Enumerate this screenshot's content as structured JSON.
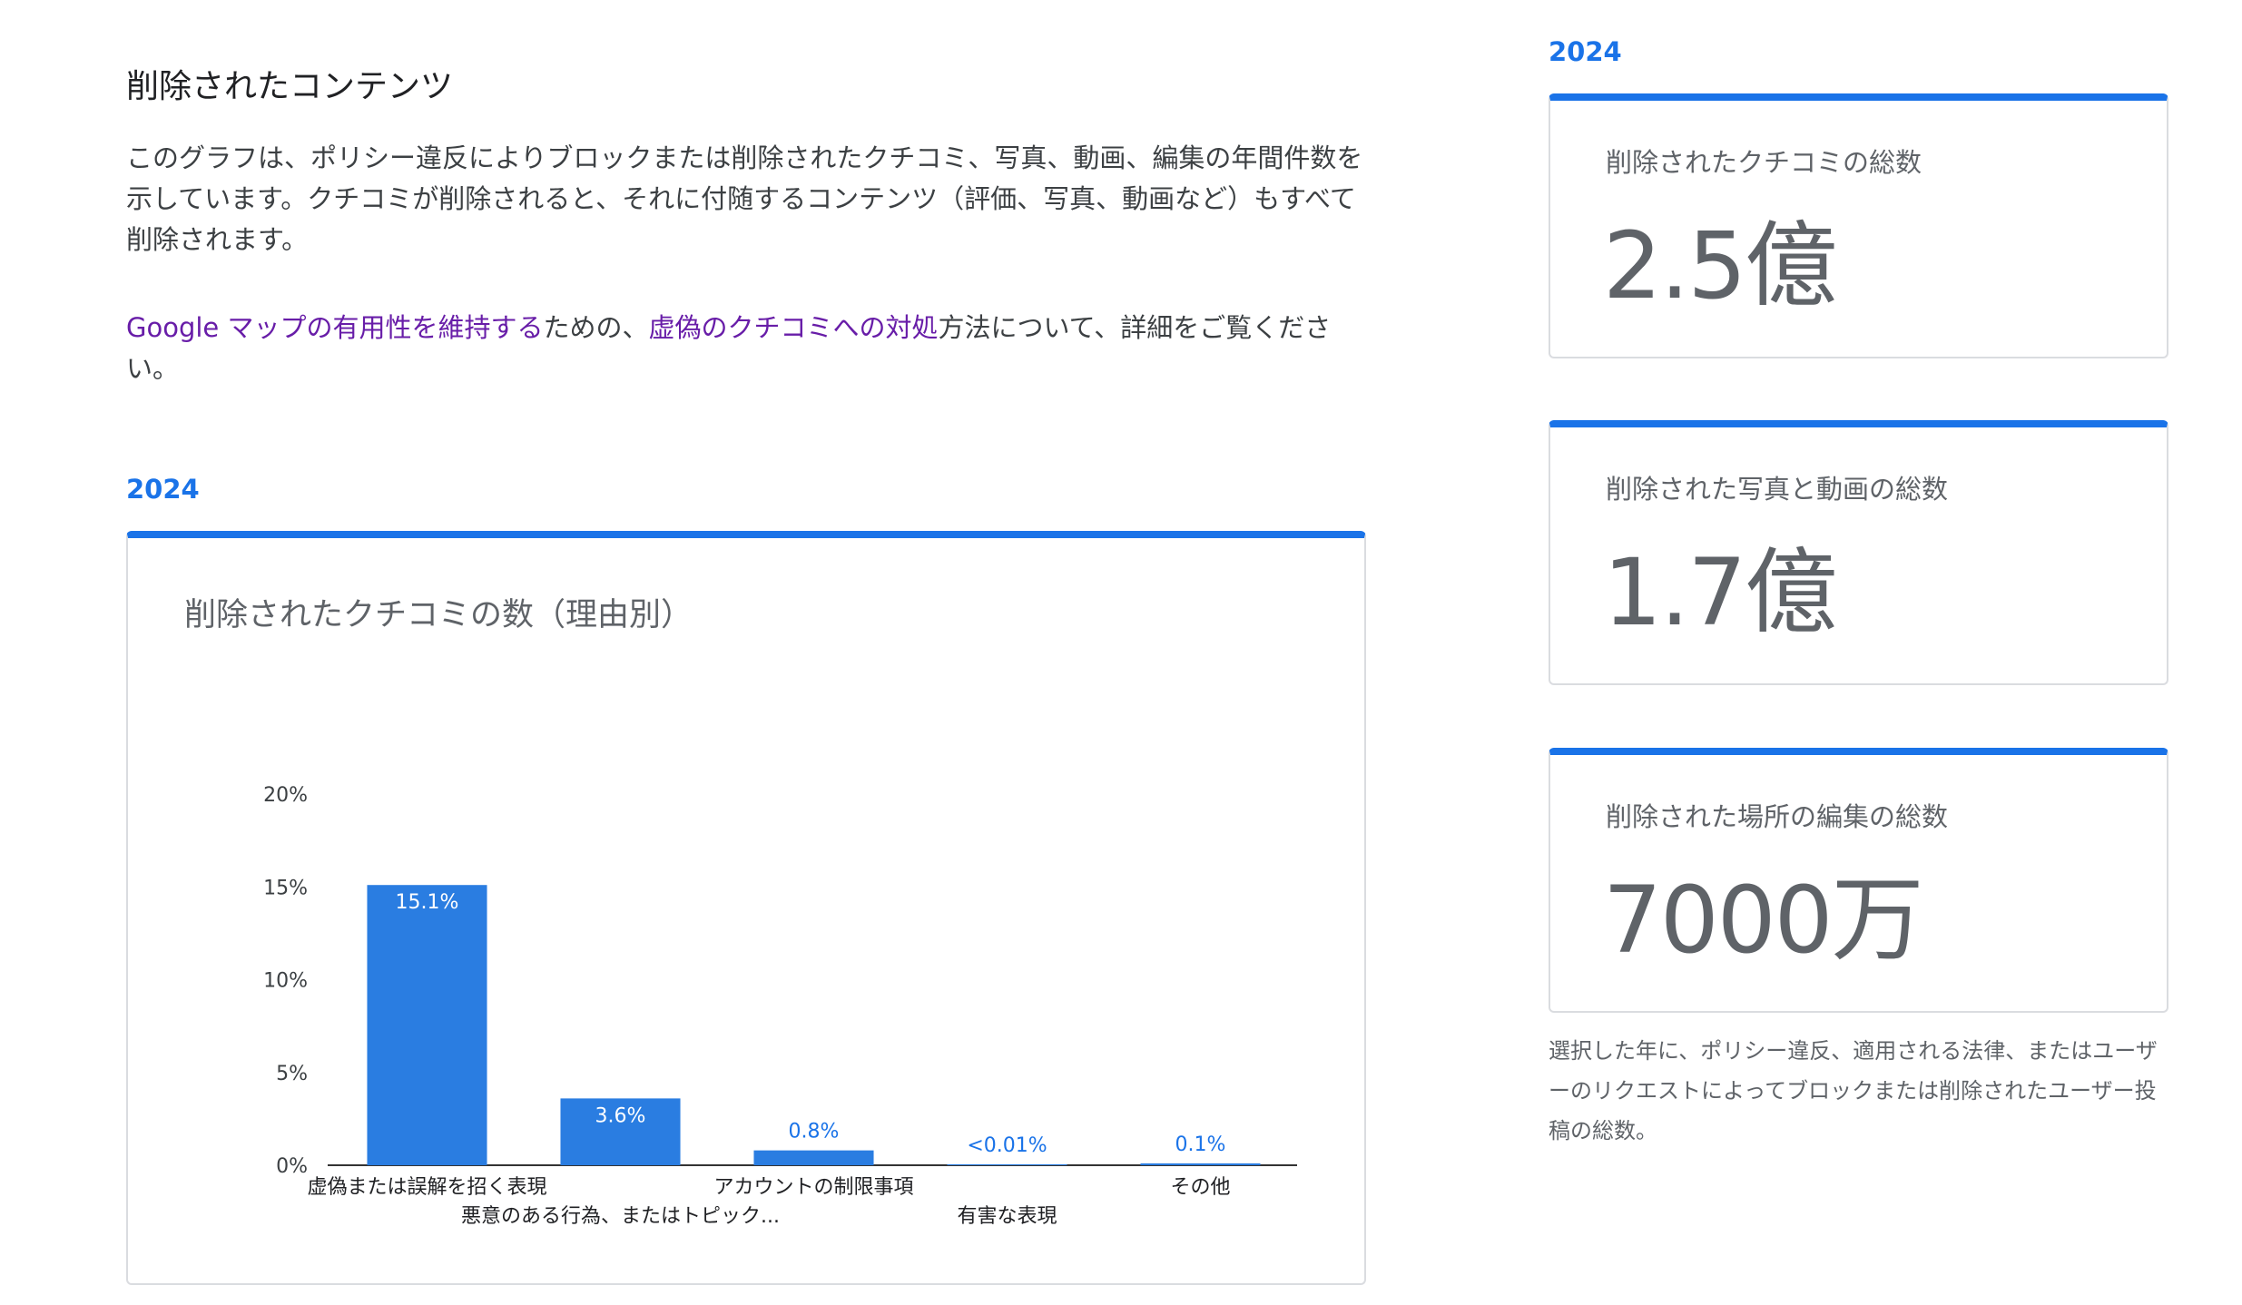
{
  "section": {
    "title": "削除されたコンテンツ",
    "description": "このグラフは、ポリシー違反によりブロックまたは削除されたクチコミ、写真、動画、編集の年間件数を示しています。クチコミが削除されると、それに付随するコンテンツ（評価、写真、動画など）もすべて削除されます。",
    "link1": "Google マップの有用性を維持する",
    "text1": "ための、",
    "link2": "虚偽のクチコミへの対処",
    "text2": "方法について、詳細をご覧ください。"
  },
  "year_left": "2024",
  "year_right": "2024",
  "stats": [
    {
      "label": "削除されたクチコミの総数",
      "value": "2.5億"
    },
    {
      "label": "削除された写真と動画の総数",
      "value": "1.7億"
    },
    {
      "label": "削除された場所の編集の総数",
      "value": "7000万"
    }
  ],
  "footnote": "選択した年に、ポリシー違反、適用される法律、またはユーザーのリクエストによってブロックまたは削除されたユーザー投稿の総数。",
  "colors": {
    "accent": "#1a73e8",
    "bar": "#2a7de1",
    "link": "#681da8"
  },
  "chart_data": {
    "type": "bar",
    "title": "削除されたクチコミの数（理由別）",
    "categories": [
      "虚偽または誤解を招く表現",
      "悪意のある行為、またはトピック...",
      "アカウントの制限事項",
      "有害な表現",
      "その他"
    ],
    "values": [
      15.1,
      3.6,
      0.8,
      0.005,
      0.1
    ],
    "data_labels": [
      "15.1%",
      "3.6%",
      "0.8%",
      "<0.01%",
      "0.1%"
    ],
    "yticks": [
      "0%",
      "5%",
      "10%",
      "15%",
      "20%"
    ],
    "ylim": [
      0,
      20
    ],
    "grid": false,
    "legend": "none"
  }
}
